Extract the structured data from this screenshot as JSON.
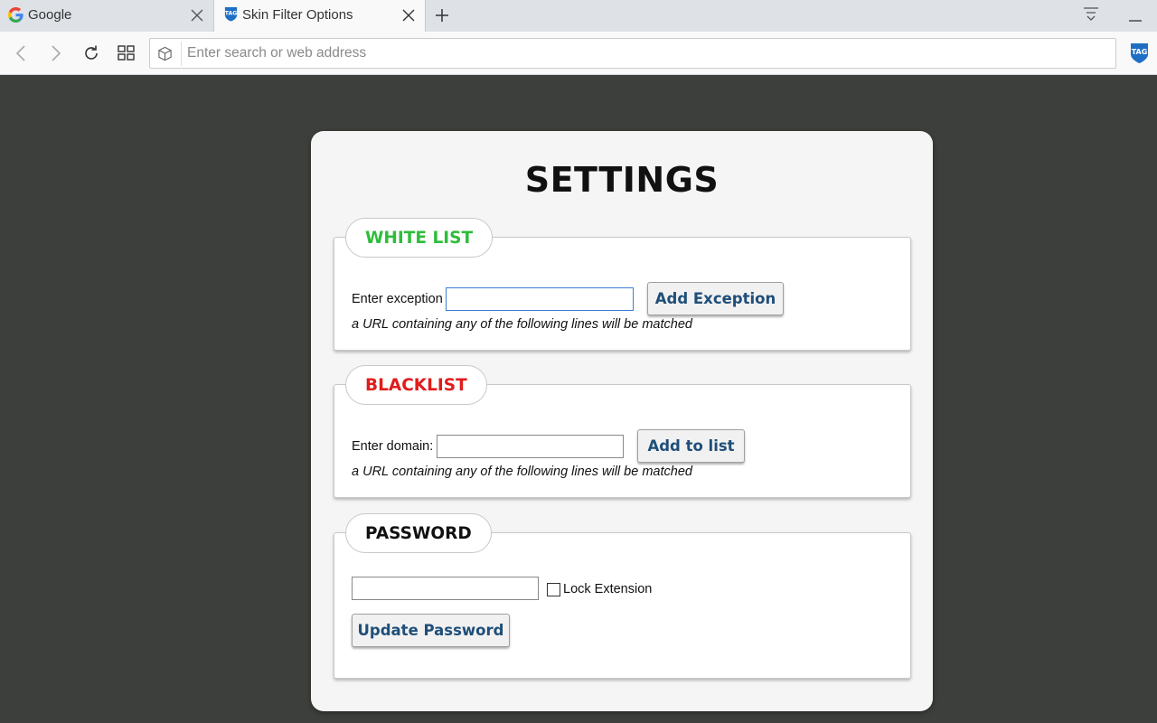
{
  "browser": {
    "tabs": [
      {
        "title": "Google",
        "icon": "google-g-icon",
        "active": false
      },
      {
        "title": "Skin Filter Options",
        "icon": "shield-tag-icon",
        "active": true
      }
    ],
    "address_bar": {
      "value": "",
      "placeholder": "Enter search or web address"
    }
  },
  "page": {
    "title": "SETTINGS",
    "whitelist": {
      "heading": "WHITE LIST",
      "heading_color": "#2ebd3b",
      "input_label": "Enter exception",
      "button_label": "Add Exception",
      "hint": "a URL containing any of the following lines will be matched"
    },
    "blacklist": {
      "heading": "BLACKLIST",
      "heading_color": "#e01c1c",
      "input_label": "Enter domain:",
      "button_label": "Add to list",
      "hint": "a URL containing any of the following lines will be matched"
    },
    "password": {
      "heading": "PASSWORD",
      "heading_color": "#111111",
      "checkbox_label": "Lock Extension",
      "checkbox_checked": false,
      "button_label": "Update Password"
    }
  },
  "colors": {
    "page_background": "#3d3f3c",
    "button_text": "#1f4e79"
  }
}
